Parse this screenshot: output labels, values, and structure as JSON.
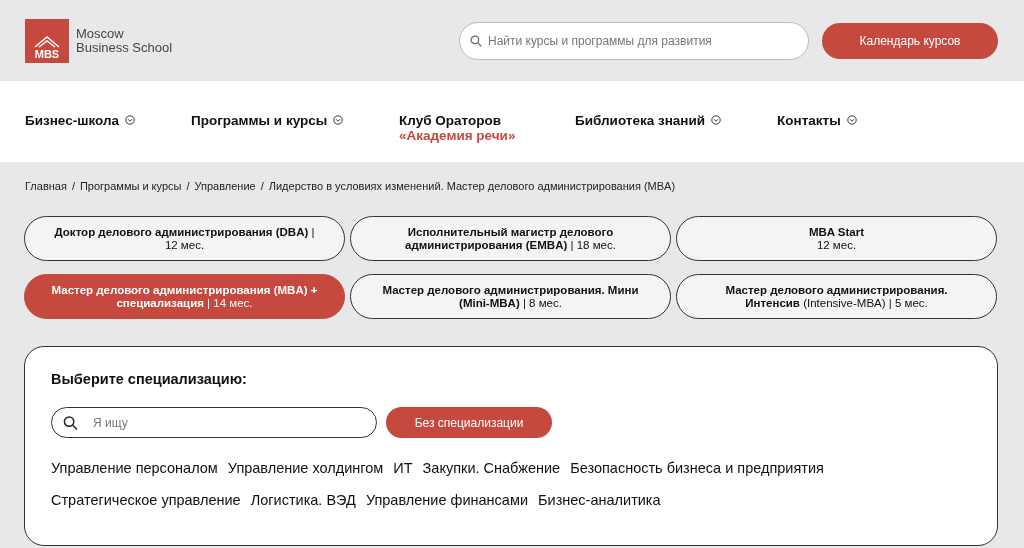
{
  "logo": {
    "mark": "MBS",
    "name_line_1": "Moscow",
    "name_line_2": "Business School"
  },
  "search": {
    "placeholder": "Найти курсы и программы для развития"
  },
  "calendar_button": "Календарь курсов",
  "nav": [
    {
      "label": "Бизнес-школа",
      "dropdown": true
    },
    {
      "label": "Программы и курсы",
      "dropdown": true
    },
    {
      "label": "Клуб Ораторов",
      "subtitle": "«Академия речи»",
      "dropdown": false
    },
    {
      "label": "Библиотека знаний",
      "dropdown": true
    },
    {
      "label": "Контакты",
      "dropdown": true
    }
  ],
  "breadcrumbs": [
    "Главная",
    "Программы и курсы",
    "Управление",
    "Лидерство в условиях изменений. Мастер делового администрирования (MBA)"
  ],
  "breadcrumb_separator": "/",
  "programs": [
    {
      "text": "**Доктор делового администрирования (DBA)** | 12 мес.",
      "selected": false
    },
    {
      "text": "**Исполнительный магистр делового администрирования (EMBA)** | 18 мес.",
      "selected": false
    },
    {
      "text": "**MBA Start**",
      "sub": "12 мес.",
      "selected": false
    },
    {
      "text": "**Мастер делового администрирования (MBA) + специализация** | 14 мес.",
      "selected": true
    },
    {
      "text": "**Мастер делового администрирования. Мини (Mini-MBA)** | 8 мес.",
      "selected": false
    },
    {
      "text": "**Мастер делового администрирования. Интенсив** (Intensive-MBA) | 5 мес.",
      "selected": false
    }
  ],
  "specialization": {
    "title": "Выберите специализацию:",
    "search_placeholder": "Я ищу",
    "none_button": "Без специализации",
    "items": [
      "Управление персоналом",
      "Управление холдингом",
      "ИТ",
      "Закупки. Снабжение",
      "Безопасность бизнеса и предприятия",
      "Стратегическое управление",
      "Логистика. ВЭД",
      "Управление финансами",
      "Бизнес-аналитика"
    ]
  }
}
